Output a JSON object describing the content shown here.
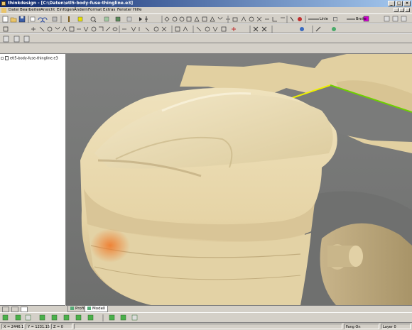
{
  "window": {
    "title": "thinkdesign - [C:\\Daten\\etl5-body-fuse-thingline.e3]",
    "minimize": "_",
    "maximize": "□",
    "close": "×"
  },
  "menubar": {
    "items": [
      "Datei",
      "Bearbeiten",
      "Ansicht",
      "Einfügen",
      "Ändern",
      "Format",
      "Extras",
      "Fenster",
      "Hilfe"
    ]
  },
  "toolbar": {
    "line_label": "Linie",
    "width_label": "Breite"
  },
  "tree": {
    "items": [
      {
        "label": "etl5-body-fuse-thingline.e3"
      }
    ]
  },
  "view_tabs": [
    {
      "label": "Profil"
    },
    {
      "label": "Modell"
    }
  ],
  "status": {
    "x": "X = 2446.1",
    "y": "Y = 1231.15",
    "z": "Z = 0",
    "snap": "Fang On",
    "layer": "Layer 0"
  },
  "colors": {
    "titlebar": "#0a246a",
    "viewport_bg": "#797a79",
    "car_body": "#eadbb3",
    "edge_yellow": "#eef000",
    "edge_green": "#6ed000",
    "magenta_swatch": "#d400d4"
  },
  "icons": {
    "app": "thinkdesign-app-icon",
    "tree_doc": "document-icon"
  }
}
